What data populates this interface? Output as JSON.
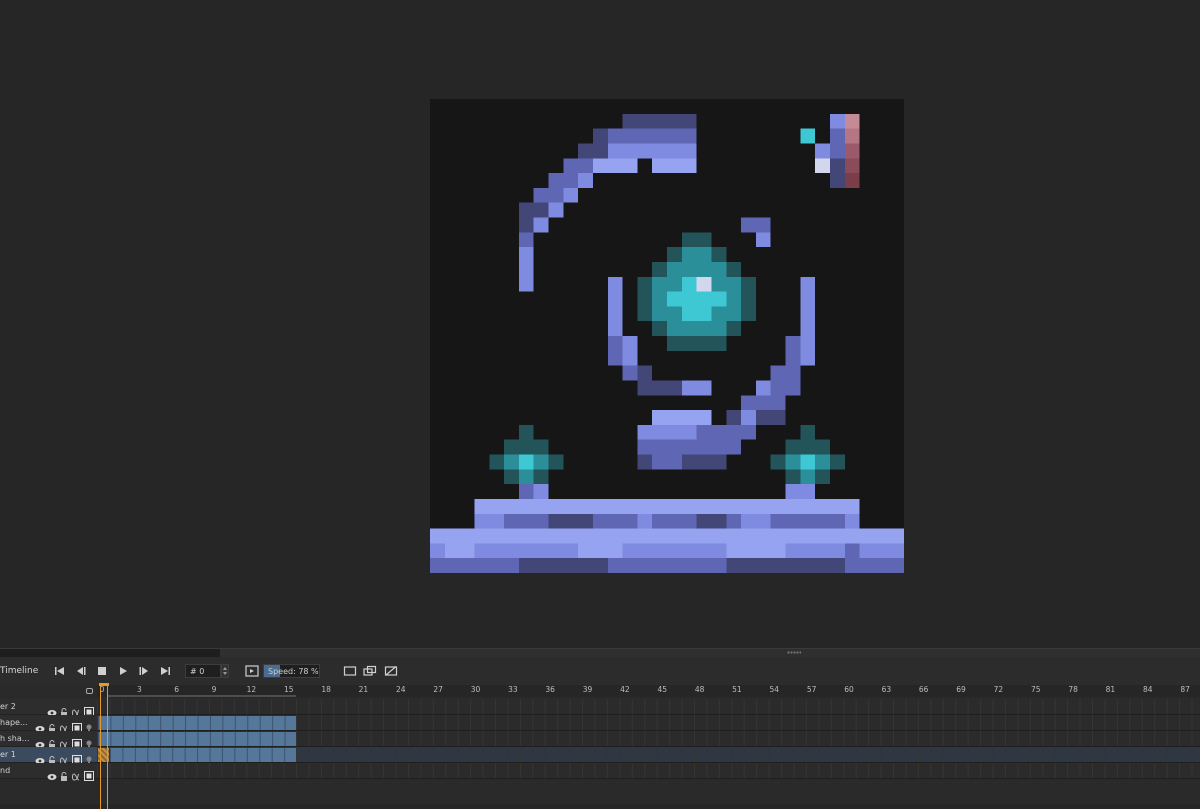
{
  "timeline": {
    "title": "Timeline",
    "frame_field": "# 0",
    "speed_label": "Speed: 78 %",
    "speed_percent": 78,
    "frame_numbers": [
      "0",
      "3",
      "6",
      "9",
      "12",
      "15",
      "18",
      "21",
      "24",
      "27",
      "30",
      "33",
      "36",
      "39",
      "42",
      "45",
      "48",
      "51",
      "54",
      "57",
      "60",
      "63",
      "66",
      "69",
      "72",
      "75",
      "78",
      "81",
      "84",
      "87"
    ],
    "layers": [
      {
        "name": "er 2",
        "selected": false,
        "frames": 0
      },
      {
        "name": "hape...",
        "selected": false,
        "frames": 16
      },
      {
        "name": "h sha...",
        "selected": false,
        "frames": 16
      },
      {
        "name": "er 1",
        "selected": true,
        "frames": 16,
        "linked_first": true
      },
      {
        "name": "nd",
        "selected": false,
        "frames": 0
      }
    ]
  },
  "colors": {
    "background": "#262626",
    "canvas_bg": "#161616",
    "periwinkle": "#7f8be0",
    "periwinkle_light": "#95a3f0",
    "indigo_mid": "#5f67b5",
    "indigo_dark": "#424778",
    "teal_light": "#3ec8d4",
    "teal_mid": "#2b8f9a",
    "teal_dark": "#23545a",
    "pale": "#d3d7ee",
    "pink": "#c48a96",
    "pink_dark": "#7a3d4a",
    "playhead": "#e49a2b",
    "cel_blue": "#55779a"
  }
}
